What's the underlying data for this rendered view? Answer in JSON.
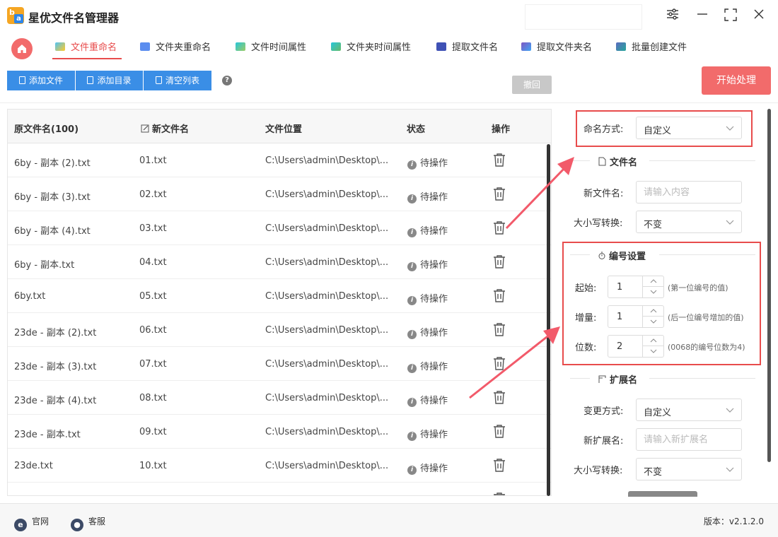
{
  "app": {
    "title": "星优文件名管理器",
    "logo_b": "b",
    "logo_a": "a"
  },
  "nav": {
    "tabs": [
      {
        "label": "文件重命名",
        "active": true
      },
      {
        "label": "文件夹重命名"
      },
      {
        "label": "文件时间属性"
      },
      {
        "label": "文件夹时间属性"
      },
      {
        "label": "提取文件名"
      },
      {
        "label": "提取文件夹名"
      },
      {
        "label": "批量创建文件"
      }
    ]
  },
  "toolbar": {
    "add_file": "添加文件",
    "add_dir": "添加目录",
    "clear_list": "清空列表",
    "help": "?",
    "undo": "撤回",
    "start": "开始处理"
  },
  "table": {
    "headers": {
      "original": "原文件名(100)",
      "new_name": "新文件名",
      "location": "文件位置",
      "status": "状态",
      "action": "操作"
    },
    "rows": [
      {
        "original": "6by - 副本 (2).txt",
        "new_name": "01.txt",
        "location": "C:\\Users\\admin\\Desktop\\...",
        "status": "待操作"
      },
      {
        "original": "6by - 副本 (3).txt",
        "new_name": "02.txt",
        "location": "C:\\Users\\admin\\Desktop\\...",
        "status": "待操作"
      },
      {
        "original": "6by - 副本 (4).txt",
        "new_name": "03.txt",
        "location": "C:\\Users\\admin\\Desktop\\...",
        "status": "待操作"
      },
      {
        "original": "6by - 副本.txt",
        "new_name": "04.txt",
        "location": "C:\\Users\\admin\\Desktop\\...",
        "status": "待操作"
      },
      {
        "original": "6by.txt",
        "new_name": "05.txt",
        "location": "C:\\Users\\admin\\Desktop\\...",
        "status": "待操作"
      },
      {
        "original": "23de - 副本 (2).txt",
        "new_name": "06.txt",
        "location": "C:\\Users\\admin\\Desktop\\...",
        "status": "待操作"
      },
      {
        "original": "23de - 副本 (3).txt",
        "new_name": "07.txt",
        "location": "C:\\Users\\admin\\Desktop\\...",
        "status": "待操作"
      },
      {
        "original": "23de - 副本 (4).txt",
        "new_name": "08.txt",
        "location": "C:\\Users\\admin\\Desktop\\...",
        "status": "待操作"
      },
      {
        "original": "23de - 副本.txt",
        "new_name": "09.txt",
        "location": "C:\\Users\\admin\\Desktop\\...",
        "status": "待操作"
      },
      {
        "original": "23de.txt",
        "new_name": "10.txt",
        "location": "C:\\Users\\admin\\Desktop\\...",
        "status": "待操作"
      }
    ]
  },
  "panel": {
    "naming_mode_label": "命名方式:",
    "naming_mode_value": "自定义",
    "filename_section": "文件名",
    "new_filename_label": "新文件名:",
    "new_filename_placeholder": "请输入内容",
    "case_label": "大小写转换:",
    "case_value": "不变",
    "numbering_section": "编号设置",
    "start_label": "起始:",
    "start_value": "1",
    "start_hint": "(第一位编号的值)",
    "step_label": "增量:",
    "step_value": "1",
    "step_hint": "(后一位编号增加的值)",
    "digits_label": "位数:",
    "digits_value": "2",
    "digits_hint": "(0068的编号位数为4)",
    "ext_section": "扩展名",
    "ext_mode_label": "变更方式:",
    "ext_mode_value": "自定义",
    "new_ext_label": "新扩展名:",
    "new_ext_placeholder": "请输入新扩展名",
    "ext_case_label": "大小写转换:",
    "ext_case_value": "不变"
  },
  "footer": {
    "website": "官网",
    "support": "客服",
    "version": "版本：v2.1.2.0"
  },
  "colors": {
    "accent_red": "#e84c4c",
    "primary_blue": "#3a8ee6",
    "start_button": "#f26b6b"
  }
}
